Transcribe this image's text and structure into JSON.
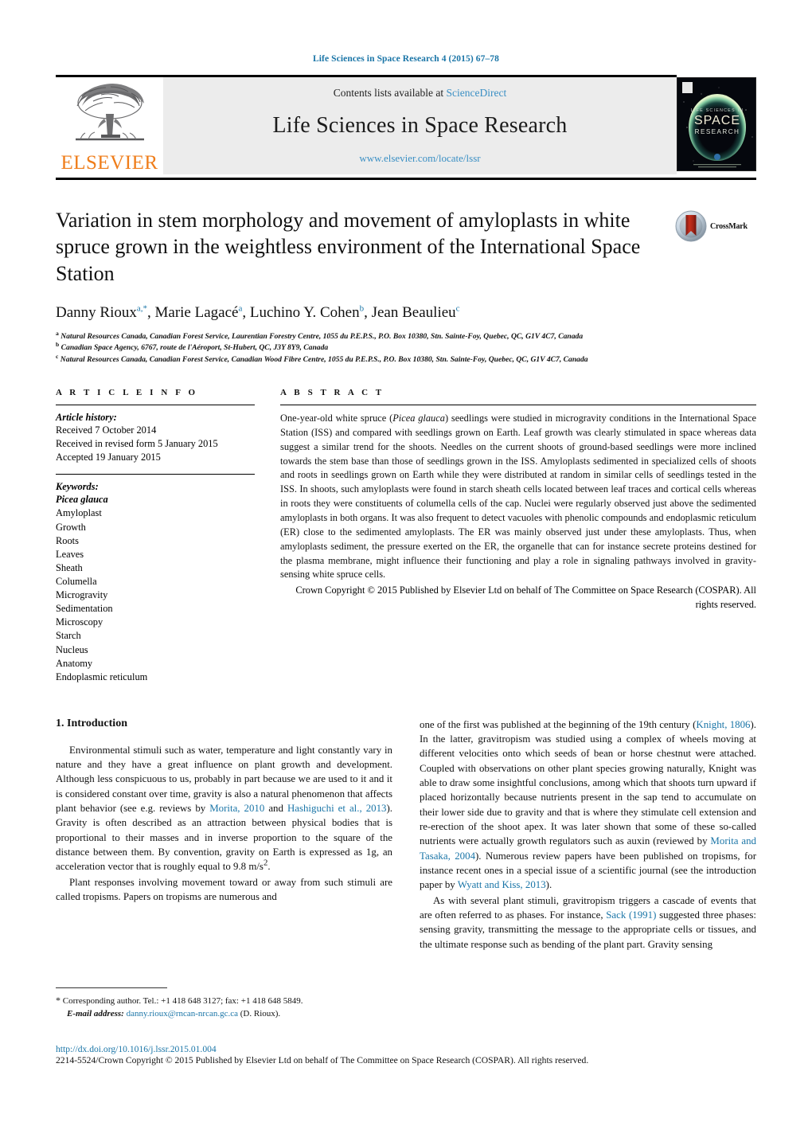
{
  "running_head": "Life Sciences in Space Research 4 (2015) 67–78",
  "masthead": {
    "contents_prefix": "Contents lists available at",
    "sciencedirect": "ScienceDirect",
    "journal_title": "Life Sciences in Space Research",
    "journal_url": "www.elsevier.com/locate/lssr",
    "publisher_logo_text": "ELSEVIER",
    "cover_line1": "LIFE SCIENCES IN",
    "cover_line2": "SPACE",
    "cover_line3": "RESEARCH"
  },
  "article": {
    "title": "Variation in stem morphology and movement of amyloplasts in white spruce grown in the weightless environment of the International Space Station",
    "crossmark_label": "CrossMark",
    "authors": [
      {
        "name": "Danny Rioux",
        "marks": "a,*"
      },
      {
        "name": "Marie Lagacé",
        "marks": "a"
      },
      {
        "name": "Luchino Y. Cohen",
        "marks": "b"
      },
      {
        "name": "Jean Beaulieu",
        "marks": "c"
      }
    ],
    "affiliations": [
      {
        "mark": "a",
        "text": "Natural Resources Canada, Canadian Forest Service, Laurentian Forestry Centre, 1055 du P.E.P.S., P.O. Box 10380, Stn. Sainte-Foy, Quebec, QC, G1V 4C7, Canada"
      },
      {
        "mark": "b",
        "text": "Canadian Space Agency, 6767, route de l'Aéroport, St-Hubert, QC, J3Y 8Y9, Canada"
      },
      {
        "mark": "c",
        "text": "Natural Resources Canada, Canadian Forest Service, Canadian Wood Fibre Centre, 1055 du P.E.P.S., P.O. Box 10380, Stn. Sainte-Foy, Quebec, QC, G1V 4C7, Canada"
      }
    ]
  },
  "article_info": {
    "heading": "A R T I C L E    I N F O",
    "history_label": "Article history:",
    "history": [
      "Received 7 October 2014",
      "Received in revised form 5 January 2015",
      "Accepted 19 January 2015"
    ],
    "keywords_label": "Keywords:",
    "keywords": [
      "Picea glauca",
      "Amyloplast",
      "Growth",
      "Roots",
      "Leaves",
      "Sheath",
      "Columella",
      "Microgravity",
      "Sedimentation",
      "Microscopy",
      "Starch",
      "Nucleus",
      "Anatomy",
      "Endoplasmic reticulum"
    ],
    "keywords_italic_first": true
  },
  "abstract": {
    "heading": "A B S T R A C T",
    "text_part1": "One-year-old white spruce (",
    "species_italic": "Picea glauca",
    "text_part2": ") seedlings were studied in microgravity conditions in the International Space Station (ISS) and compared with seedlings grown on Earth. Leaf growth was clearly stimulated in space whereas data suggest a similar trend for the shoots. Needles on the current shoots of ground-based seedlings were more inclined towards the stem base than those of seedlings grown in the ISS. Amyloplasts sedimented in specialized cells of shoots and roots in seedlings grown on Earth while they were distributed at random in similar cells of seedlings tested in the ISS. In shoots, such amyloplasts were found in starch sheath cells located between leaf traces and cortical cells whereas in roots they were constituents of columella cells of the cap. Nuclei were regularly observed just above the sedimented amyloplasts in both organs. It was also frequent to detect vacuoles with phenolic compounds and endoplasmic reticulum (ER) close to the sedimented amyloplasts. The ER was mainly observed just under these amyloplasts. Thus, when amyloplasts sediment, the pressure exerted on the ER, the organelle that can for instance secrete proteins destined for the plasma membrane, might influence their functioning and play a role in signaling pathways involved in gravity-sensing white spruce cells.",
    "copyright": "Crown Copyright © 2015 Published by Elsevier Ltd on behalf of The Committee on Space Research (COSPAR). All rights reserved."
  },
  "introduction": {
    "section_title": "1. Introduction",
    "left_para_1_a": "Environmental stimuli such as water, temperature and light constantly vary in nature and they have a great influence on plant growth and development. Although less conspicuous to us, probably in part because we are used to it and it is considered constant over time, gravity is also a natural phenomenon that affects plant behavior (see e.g. reviews by ",
    "left_ref_1": "Morita, 2010",
    "left_para_1_b": " and ",
    "left_ref_2": "Hashiguchi et al., 2013",
    "left_para_1_c": "). Gravity is often described as an attraction between physical bodies that is proportional to their masses and in inverse proportion to the square of the distance between them. By convention, gravity on Earth is expressed as 1g, an acceleration vector that is roughly equal to 9.8 m/s",
    "left_para_1_sup": "2",
    "left_para_1_d": ".",
    "left_para_2": "Plant responses involving movement toward or away from such stimuli are called tropisms. Papers on tropisms are numerous and",
    "right_para_1_a": "one of the first was published at the beginning of the 19th century (",
    "right_ref_1": "Knight, 1806",
    "right_para_1_b": "). In the latter, gravitropism was studied using a complex of wheels moving at different velocities onto which seeds of bean or horse chestnut were attached. Coupled with observations on other plant species growing naturally, Knight was able to draw some insightful conclusions, among which that shoots turn upward if placed horizontally because nutrients present in the sap tend to accumulate on their lower side due to gravity and that is where they stimulate cell extension and re-erection of the shoot apex. It was later shown that some of these so-called nutrients were actually growth regulators such as auxin (reviewed by ",
    "right_ref_2": "Morita and Tasaka, 2004",
    "right_para_1_c": "). Numerous review papers have been published on tropisms, for instance recent ones in a special issue of a scientific journal (see the introduction paper by ",
    "right_ref_3": "Wyatt and Kiss, 2013",
    "right_para_1_d": ").",
    "right_para_2_a": "As with several plant stimuli, gravitropism triggers a cascade of events that are often referred to as phases. For instance, ",
    "right_ref_4": "Sack (1991)",
    "right_para_2_b": " suggested three phases: sensing gravity, transmitting the message to the appropriate cells or tissues, and the ultimate response such as bending of the plant part. Gravity sensing"
  },
  "footnotes": {
    "star": "*",
    "corresponding": "Corresponding author. Tel.: +1 418 648 3127; fax: +1 418 648 5849.",
    "email_label": "E-mail address:",
    "email": "danny.rioux@rncan-nrcan.gc.ca",
    "email_owner": "(D. Rioux)."
  },
  "footer": {
    "doi": "http://dx.doi.org/10.1016/j.lssr.2015.01.004",
    "issn_copyright": "2214-5524/Crown Copyright © 2015 Published by Elsevier Ltd on behalf of The Committee on Space Research (COSPAR). All rights reserved."
  },
  "colors": {
    "link_blue": "#1a75a7",
    "elsevier_orange": "#ef7d1a",
    "band_grey": "#ececec",
    "sciencedirect_blue": "#3a8fc4"
  }
}
